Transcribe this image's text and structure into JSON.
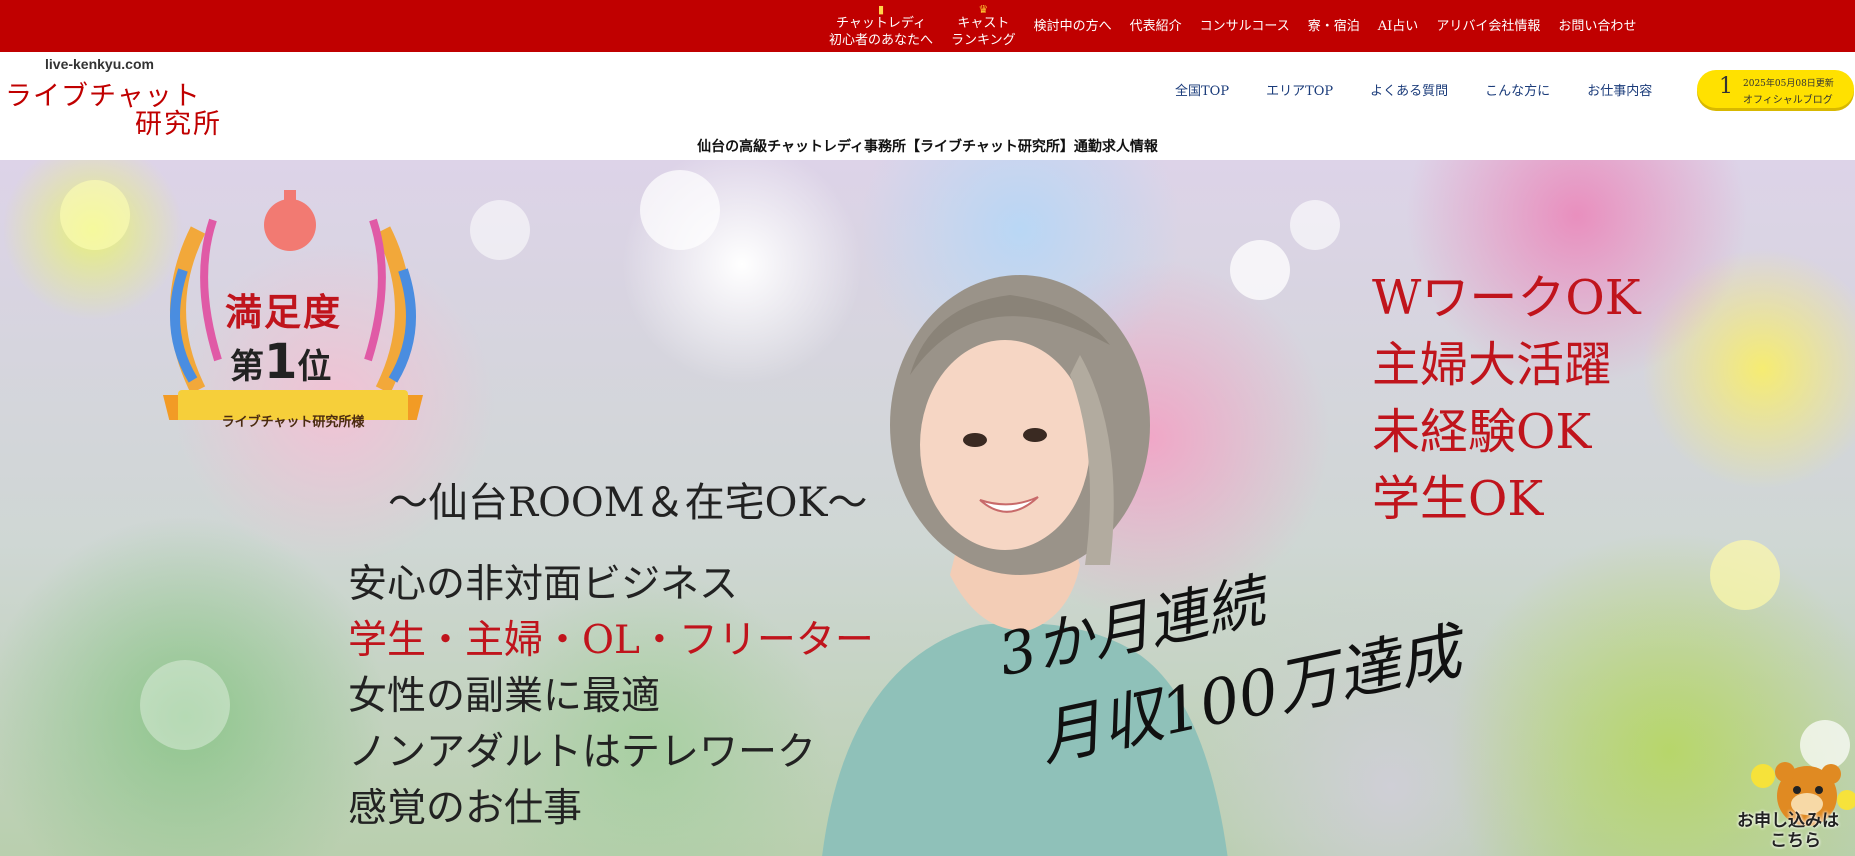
{
  "top_nav": {
    "items": [
      {
        "line1": "チャットレディ",
        "line2": "初心者のあなたへ",
        "icon": "book-icon"
      },
      {
        "line1": "キャスト",
        "line2": "ランキング",
        "icon": "crown-icon"
      },
      {
        "label": "検討中の方へ"
      },
      {
        "label": "代表紹介"
      },
      {
        "label": "コンサルコース"
      },
      {
        "label": "寮・宿泊"
      },
      {
        "label": "AI占い"
      },
      {
        "label": "アリバイ会社情報"
      },
      {
        "label": "お問い合わせ"
      }
    ],
    "bg_color": "#c00000"
  },
  "logo": {
    "domain": "live-kenkyu.com",
    "line1": "ライブチャット",
    "line2": "研究所"
  },
  "main_nav": [
    "全国TOP",
    "エリアTOP",
    "よくある質問",
    "こんな方に",
    "お仕事内容"
  ],
  "blog_button": {
    "number": "1",
    "date": "2025年05月08日更新",
    "label": "オフィシャルブログ",
    "color": "#ffe100"
  },
  "subtitle": "仙台の高級チャットレディ事務所【ライブチャット研究所】通勤求人情報",
  "hero": {
    "award": {
      "line1": "満足度",
      "line2_pre": "第",
      "line2_num": "1",
      "line2_post": "位",
      "ribbon": "ライブチャット研究所様"
    },
    "sendai": "～仙台ROOM＆在宅OK～",
    "copy": [
      "安心の非対面ビジネス",
      "学生・主婦・OL・フリーター",
      "女性の副業に最適",
      "ノンアダルトはテレワーク",
      "感覚のお仕事"
    ],
    "right_copy": [
      "WワークOK",
      "主婦大活躍",
      "未経験OK",
      "学生OK"
    ],
    "handwritten": [
      "3か月連続",
      "月収100万達成"
    ],
    "accent_color": "#c0141c"
  },
  "mascot": {
    "text_line1": "お申し込みは",
    "text_line2": "こちら"
  }
}
